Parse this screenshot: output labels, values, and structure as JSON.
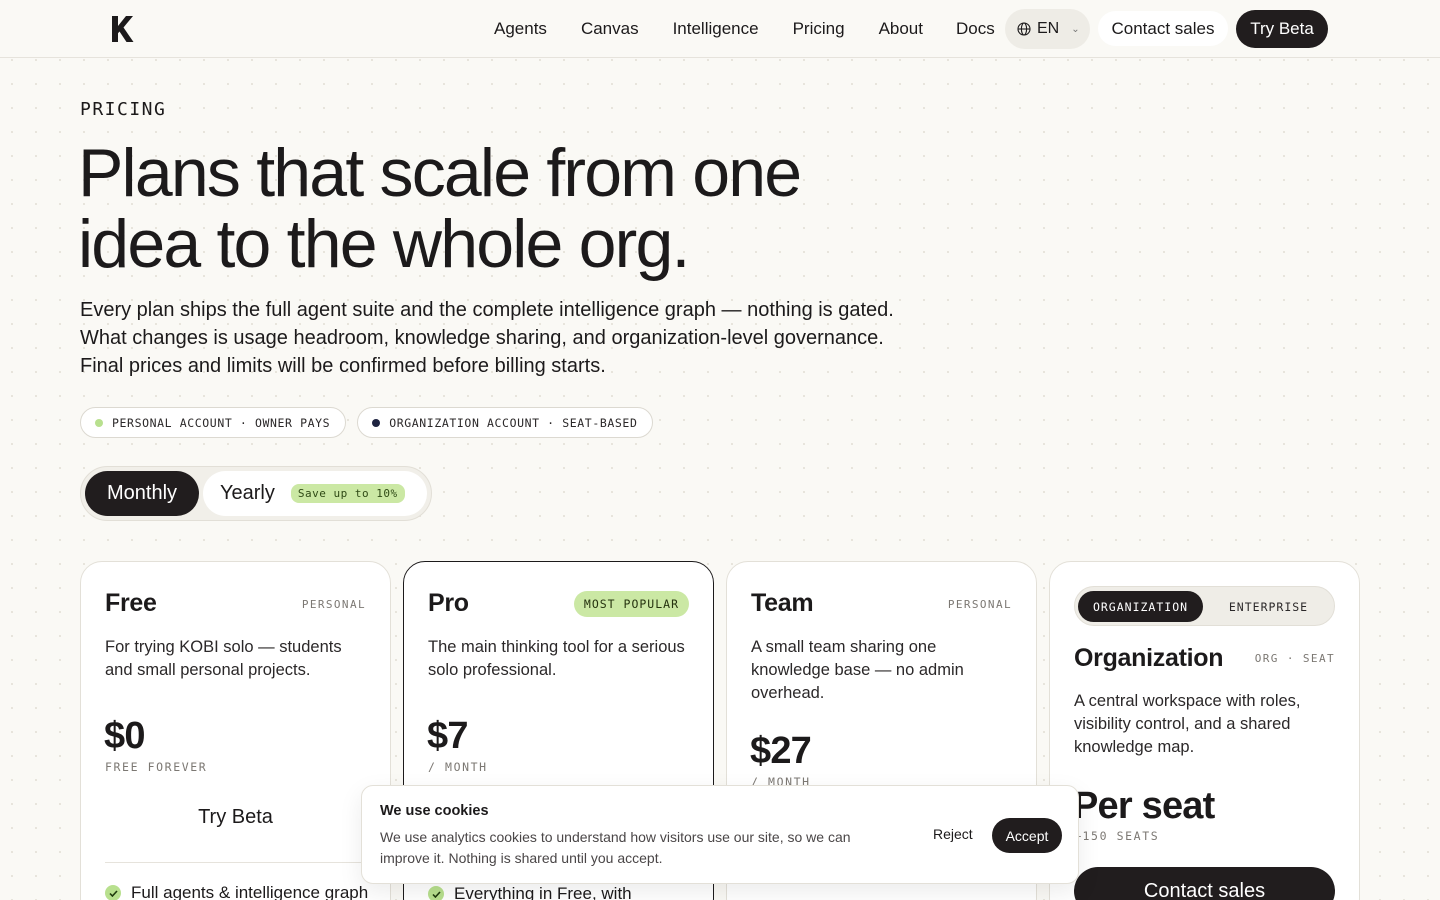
{
  "nav": {
    "links": [
      "Agents",
      "Canvas",
      "Intelligence",
      "Pricing",
      "About",
      "Docs"
    ],
    "language": "EN",
    "contact_label": "Contact sales",
    "beta_label": "Try Beta"
  },
  "hero": {
    "eyebrow": "PRICING",
    "headline_line1": "Plans that scale from one",
    "headline_line2": "idea to the whole org.",
    "lead_line1": "Every plan ships the full agent suite and the complete intelligence graph — nothing is gated.",
    "lead_line2": "What changes is usage headroom, knowledge sharing, and organization-level governance.",
    "lead_line3": "Final prices and limits will be confirmed before billing starts.",
    "pills": [
      {
        "label": "PERSONAL ACCOUNT · OWNER PAYS",
        "dot_color": "#b8e08e"
      },
      {
        "label": "ORGANIZATION ACCOUNT · SEAT-BASED",
        "dot_color": "#1e2340"
      }
    ]
  },
  "billing_toggle": {
    "monthly": "Monthly",
    "yearly": "Yearly",
    "save_badge": "Save up to 10%",
    "selected": "Monthly"
  },
  "plans": [
    {
      "name": "Free",
      "tag": "PERSONAL",
      "description": "For trying KOBI solo — students and small personal projects.",
      "price": "$0",
      "price_sub": "FREE FOREVER",
      "cta": "Try Beta",
      "feature": "Full agents & intelligence graph"
    },
    {
      "name": "Pro",
      "badge": "MOST POPULAR",
      "description": "The main thinking tool for a serious solo professional.",
      "price": "$7",
      "price_sub": "/ MONTH",
      "feature": "Everything in Free, with"
    },
    {
      "name": "Team",
      "tag": "PERSONAL",
      "description": "A small team sharing one knowledge base — no admin overhead.",
      "price": "$27",
      "price_sub": "/ MONTH"
    }
  ],
  "org_plan": {
    "tab_org": "ORGANIZATION",
    "tab_enterprise": "ENTERPRISE",
    "selected_tab": "ORGANIZATION",
    "name": "Organization",
    "tag": "ORG · SEAT",
    "description": "A central workspace with roles, visibility control, and a shared knowledge map.",
    "price": "Per seat",
    "price_sub": "–150 SEATS",
    "cta": "Contact sales"
  },
  "cookie": {
    "title": "We use cookies",
    "text": "We use analytics cookies to understand how visitors use our site, so we can improve it. Nothing is shared until you accept.",
    "reject": "Reject",
    "accept": "Accept"
  }
}
